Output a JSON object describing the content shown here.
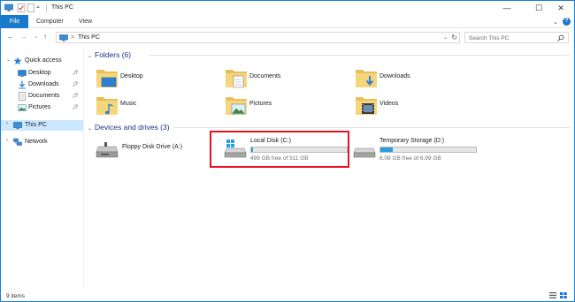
{
  "window": {
    "title": "This PC",
    "controls": {
      "minimize": "—",
      "maximize": "☐",
      "close": "✕"
    }
  },
  "ribbon": {
    "tabs": [
      "File",
      "Computer",
      "View"
    ],
    "help": "?"
  },
  "nav": {
    "back": "←",
    "forward": "→",
    "recent": "⌄",
    "up": "↑",
    "address_segment": "This PC",
    "address_sep": ">",
    "search_placeholder": "Search This PC"
  },
  "sidebar": {
    "items": [
      {
        "label": "Quick access",
        "icon": "star-icon"
      },
      {
        "label": "Desktop",
        "icon": "desktop-folder-icon",
        "pinned": true
      },
      {
        "label": "Downloads",
        "icon": "downloads-folder-icon",
        "pinned": true
      },
      {
        "label": "Documents",
        "icon": "documents-folder-icon",
        "pinned": true
      },
      {
        "label": "Pictures",
        "icon": "pictures-folder-icon",
        "pinned": true
      },
      {
        "label": "This PC",
        "icon": "computer-icon",
        "selected": true
      },
      {
        "label": "Network",
        "icon": "network-icon"
      }
    ]
  },
  "folders": {
    "header": "Folders (6)",
    "items": [
      {
        "label": "Desktop",
        "icon": "desktop-folder-icon"
      },
      {
        "label": "Documents",
        "icon": "documents-folder-icon"
      },
      {
        "label": "Downloads",
        "icon": "downloads-folder-icon"
      },
      {
        "label": "Music",
        "icon": "music-folder-icon"
      },
      {
        "label": "Pictures",
        "icon": "pictures-folder-icon"
      },
      {
        "label": "Videos",
        "icon": "videos-folder-icon"
      }
    ]
  },
  "drives": {
    "header": "Devices and drives (3)",
    "items": [
      {
        "name": "Floppy Disk Drive (A:)",
        "free_text": "",
        "used_fraction": null,
        "icon": "floppy-drive-icon"
      },
      {
        "name": "Local Disk (C:)",
        "free_text": "499 GB free of 511 GB",
        "used_fraction": 0.023,
        "icon": "windows-drive-icon"
      },
      {
        "name": "Temporary Storage (D:)",
        "free_text": "6.08 GB free of 6.99 GB",
        "used_fraction": 0.13,
        "icon": "hard-drive-icon"
      }
    ]
  },
  "status": {
    "item_count": "9 items"
  },
  "colors": {
    "accent": "#1979ca",
    "selection": "#cce8ff",
    "highlight_box": "#e81123",
    "bar_fill": "#26a0da"
  }
}
